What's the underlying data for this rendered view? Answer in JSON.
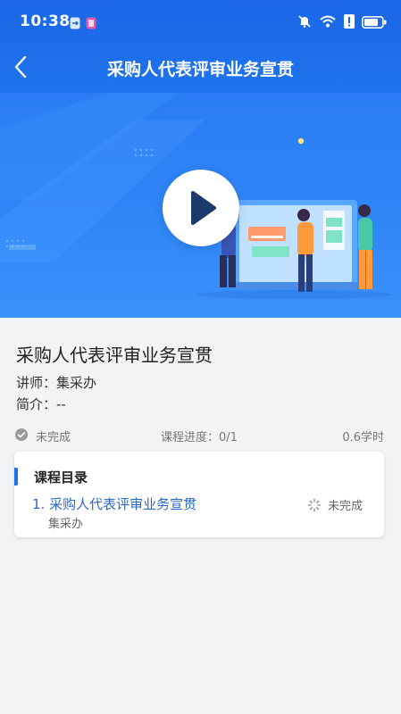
{
  "status_bar": {
    "time": "10:38"
  },
  "nav": {
    "title": "采购人代表评审业务宣贯"
  },
  "course": {
    "title": "采购人代表评审业务宣贯",
    "teacher_label": "讲师：",
    "teacher_name": "集采办",
    "intro_label": "简介：",
    "intro_value": "--",
    "status": "未完成",
    "progress_label": "课程进度：",
    "progress_value": "0/1",
    "hours": "0.6学时"
  },
  "catalog": {
    "title": "课程目录",
    "items": [
      {
        "title": "1. 采购人代表评审业务宣贯",
        "subtitle": "集采办",
        "status": "未完成"
      }
    ]
  },
  "colors": {
    "header_blue": "#1a66e6",
    "accent_blue": "#1f6fe8",
    "link_blue": "#2a68c7"
  }
}
